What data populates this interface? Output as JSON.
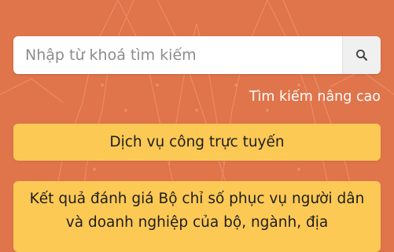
{
  "search": {
    "placeholder": "Nhập từ khoá tìm kiếm",
    "value": ""
  },
  "icons": {
    "search_button": "search-icon"
  },
  "links": {
    "advanced_search": "Tìm kiếm nâng cao"
  },
  "buttons": {
    "online_services": "Dịch vụ công trực tuyến",
    "evaluation_results": "Kết quả đánh giá Bộ chỉ số phục vụ người dân và doanh nghiệp của bộ, ngành, địa"
  },
  "colors": {
    "background": "#e0744a",
    "button_yellow": "#fcc955",
    "link_text": "#ffffff"
  }
}
